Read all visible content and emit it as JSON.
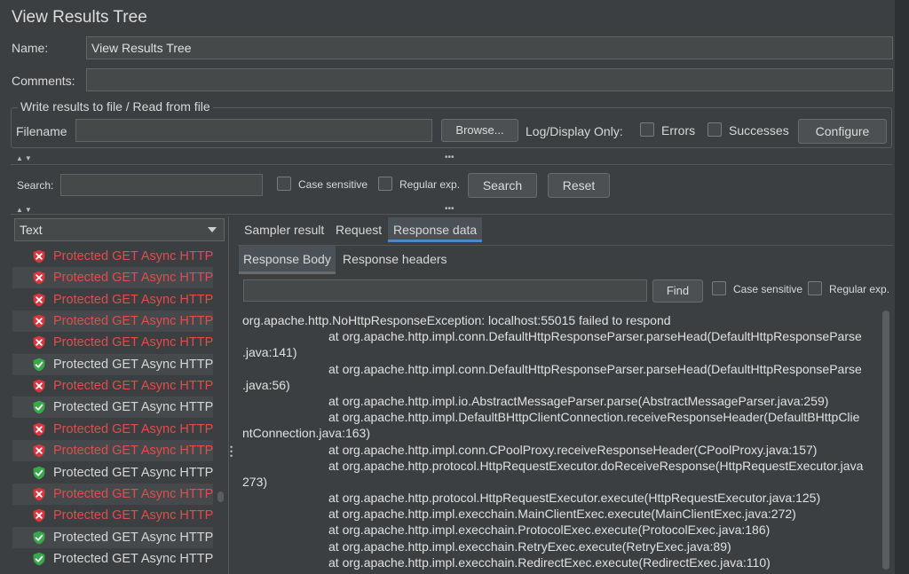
{
  "title": "View Results Tree",
  "name_label": "Name:",
  "name_value": "View Results Tree",
  "comments_label": "Comments:",
  "comments_value": "",
  "file_group": {
    "title": "Write results to file / Read from file",
    "filename_label": "Filename",
    "filename_value": "",
    "browse_label": "Browse...",
    "log_display_label": "Log/Display Only:",
    "errors_label": "Errors",
    "successes_label": "Successes",
    "configure_label": "Configure"
  },
  "search": {
    "label": "Search:",
    "value": "",
    "case_sensitive_label": "Case sensitive",
    "regex_label": "Regular exp.",
    "search_button": "Search",
    "reset_button": "Reset"
  },
  "renderer_select": "Text",
  "tree_items": [
    {
      "label": "Protected GET Async HTTP",
      "status": "error"
    },
    {
      "label": "Protected GET Async HTTP",
      "status": "error"
    },
    {
      "label": "Protected GET Async HTTP",
      "status": "error"
    },
    {
      "label": "Protected GET Async HTTP",
      "status": "error"
    },
    {
      "label": "Protected GET Async HTTP",
      "status": "error"
    },
    {
      "label": "Protected GET Async HTTP",
      "status": "success"
    },
    {
      "label": "Protected GET Async HTTP",
      "status": "error"
    },
    {
      "label": "Protected GET Async HTTP",
      "status": "success"
    },
    {
      "label": "Protected GET Async HTTP",
      "status": "error"
    },
    {
      "label": "Protected GET Async HTTP",
      "status": "error"
    },
    {
      "label": "Protected GET Async HTTP",
      "status": "success"
    },
    {
      "label": "Protected GET Async HTTP",
      "status": "error"
    },
    {
      "label": "Protected GET Async HTTP",
      "status": "error"
    },
    {
      "label": "Protected GET Async HTTP",
      "status": "success"
    },
    {
      "label": "Protected GET Async HTTP",
      "status": "success"
    }
  ],
  "tabs": [
    "Sampler result",
    "Request",
    "Response data"
  ],
  "subtabs": [
    "Response Body",
    "Response headers"
  ],
  "find": {
    "value": "",
    "button": "Find",
    "case_sensitive_label": "Case sensitive",
    "regex_label": "Regular exp."
  },
  "response_lines": [
    {
      "text": "org.apache.http.NoHttpResponseException: localhost:55015 failed to respond",
      "indent": false
    },
    {
      "text": "at org.apache.http.impl.conn.DefaultHttpResponseParser.parseHead(DefaultHttpResponseParse",
      "indent": true
    },
    {
      "text": ".java:141)",
      "indent": false
    },
    {
      "text": "at org.apache.http.impl.conn.DefaultHttpResponseParser.parseHead(DefaultHttpResponseParse",
      "indent": true
    },
    {
      "text": ".java:56)",
      "indent": false
    },
    {
      "text": "at org.apache.http.impl.io.AbstractMessageParser.parse(AbstractMessageParser.java:259)",
      "indent": true
    },
    {
      "text": "at org.apache.http.impl.DefaultBHttpClientConnection.receiveResponseHeader(DefaultBHttpClie",
      "indent": true
    },
    {
      "text": "ntConnection.java:163)",
      "indent": false
    },
    {
      "text": "at org.apache.http.impl.conn.CPoolProxy.receiveResponseHeader(CPoolProxy.java:157)",
      "indent": true
    },
    {
      "text": "at org.apache.http.protocol.HttpRequestExecutor.doReceiveResponse(HttpRequestExecutor.java",
      "indent": true
    },
    {
      "text": "273)",
      "indent": false
    },
    {
      "text": "at org.apache.http.protocol.HttpRequestExecutor.execute(HttpRequestExecutor.java:125)",
      "indent": true
    },
    {
      "text": "at org.apache.http.impl.execchain.MainClientExec.execute(MainClientExec.java:272)",
      "indent": true
    },
    {
      "text": "at org.apache.http.impl.execchain.ProtocolExec.execute(ProtocolExec.java:186)",
      "indent": true
    },
    {
      "text": "at org.apache.http.impl.execchain.RetryExec.execute(RetryExec.java:89)",
      "indent": true
    },
    {
      "text": "at org.apache.http.impl.execchain.RedirectExec.execute(RedirectExec.java:110)",
      "indent": true
    }
  ],
  "colors": {
    "background": "#3c3f41",
    "error_text": "#e44b4b",
    "error_icon": "#d9363e",
    "success_icon": "#39a84a",
    "active_tab_underline": "#4a88c7"
  }
}
